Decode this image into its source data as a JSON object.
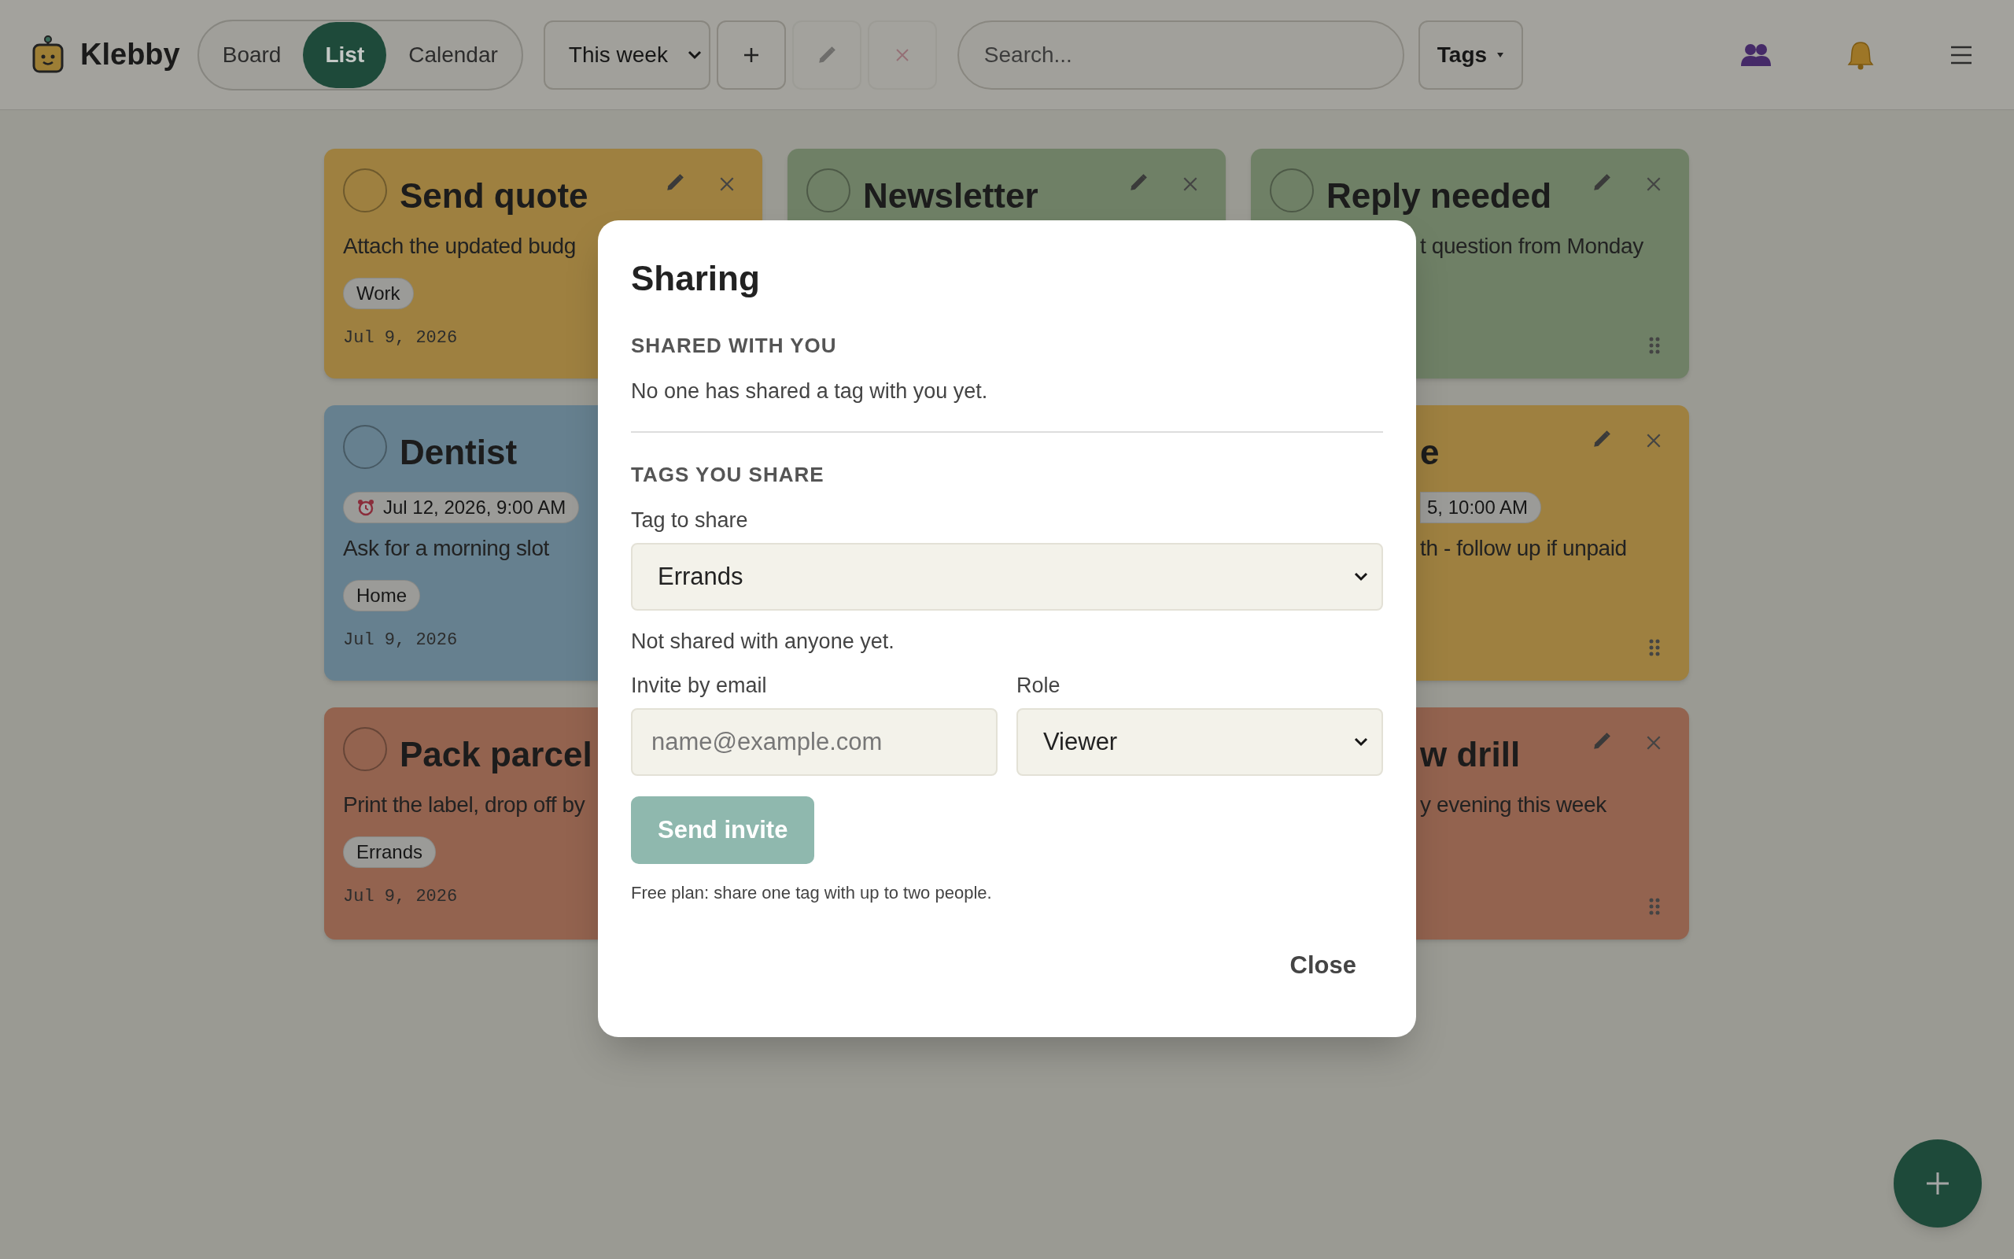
{
  "app": {
    "name": "Klebby"
  },
  "views": [
    {
      "label": "Board",
      "selected": false
    },
    {
      "label": "List",
      "selected": true
    },
    {
      "label": "Calendar",
      "selected": false
    }
  ],
  "range_select": {
    "value": "This week"
  },
  "toolbar": [
    {
      "kind": "add",
      "disabled": false
    },
    {
      "kind": "edit",
      "disabled": true
    },
    {
      "kind": "delete",
      "disabled": true
    }
  ],
  "search": {
    "placeholder": "Search..."
  },
  "tags_button": {
    "label": "Tags"
  },
  "card_columns": [
    [
      {
        "color": "#9e8040",
        "title": "Send quote",
        "description": "Attach the updated budg",
        "tag": "Work",
        "date": "Jul 9, 2026"
      },
      {
        "color": "#66808f",
        "title": "Dentist",
        "reminder": "Jul 12, 2026, 9:00 AM",
        "description": "Ask for a morning slot",
        "tag": "Home",
        "date": "Jul 9, 2026"
      },
      {
        "color": "#93634f",
        "title": "Pack parcel",
        "description": "Print the label, drop off by",
        "tag": "Errands",
        "date": "Jul 9, 2026"
      }
    ],
    [
      {
        "color": "#6f8066",
        "title": "Newsletter"
      }
    ],
    [
      {
        "color": "#6f8066",
        "title": "Reply needed",
        "description": "t question from Monday"
      },
      {
        "color": "#9e8040",
        "title": "e",
        "reminder": "5, 10:00 AM",
        "description": "th - follow up if unpaid"
      },
      {
        "color": "#93634f",
        "title": "w drill",
        "description": "y evening this week"
      }
    ]
  ],
  "dialog": {
    "title": "Sharing",
    "shared_with_you": {
      "heading": "SHARED WITH YOU",
      "empty_text": "No one has shared a tag with you yet."
    },
    "tags_you_share": {
      "heading": "TAGS YOU SHARE",
      "tag_label": "Tag to share",
      "tag_value": "Errands",
      "status_text": "Not shared with anyone yet.",
      "email_label": "Invite by email",
      "email_placeholder": "name@example.com",
      "role_label": "Role",
      "role_value": "Viewer"
    },
    "send_button": {
      "label": "Send invite",
      "disabled": true
    },
    "note": "Free plan: share one tag with up to two people.",
    "close_button": "Close"
  }
}
